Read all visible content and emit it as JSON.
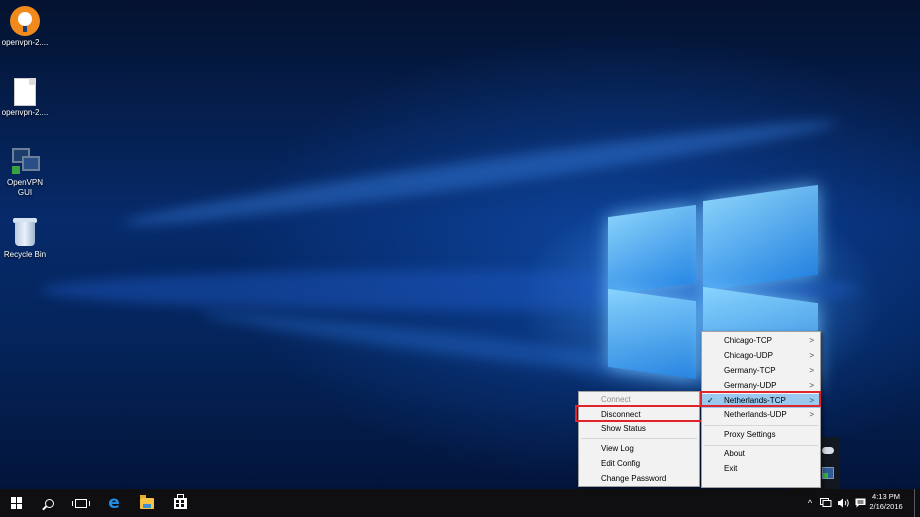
{
  "desktop": {
    "icons": [
      {
        "label": "openvpn-2....",
        "icon": "openvpn-logo-icon"
      },
      {
        "label": "openvpn-2....",
        "icon": "file-icon"
      },
      {
        "label_line1": "OpenVPN",
        "label_line2": "GUI",
        "icon": "openvpn-gui-icon"
      },
      {
        "label": "Recycle Bin",
        "icon": "recycle-bin-icon"
      }
    ]
  },
  "openvpn_menu": {
    "items": [
      {
        "label": "Connect",
        "enabled": false
      },
      {
        "label": "Disconnect",
        "highlighted_box": true
      },
      {
        "label": "Show Status"
      },
      {
        "label": "View Log"
      },
      {
        "label": "Edit Config"
      },
      {
        "label": "Change Password"
      }
    ]
  },
  "connections_menu": {
    "items": [
      {
        "label": "Chicago-TCP",
        "submenu": ">"
      },
      {
        "label": "Chicago-UDP",
        "submenu": ">"
      },
      {
        "label": "Germany-TCP",
        "submenu": ">"
      },
      {
        "label": "Germany-UDP",
        "submenu": ">"
      },
      {
        "label": "Netherlands-TCP",
        "submenu": ">",
        "checked": "✓",
        "selected": true
      },
      {
        "label": "Netherlands-UDP",
        "submenu": ">"
      },
      {
        "label": "Proxy Settings"
      },
      {
        "label": "About"
      },
      {
        "label": "Exit"
      }
    ]
  },
  "taskbar": {
    "pinned": [
      "start-icon",
      "search-icon",
      "task-view-icon",
      "edge-icon",
      "file-explorer-icon",
      "store-icon"
    ],
    "tray": {
      "chevron": "^",
      "network": "network-icon",
      "volume": "volume-icon",
      "notifications": "action-center-icon"
    },
    "time": "4:13 PM",
    "date": "2/16/2016"
  },
  "colors": {
    "highlight": "#99c9ef",
    "red_box": "#e0242b",
    "menu_bg": "#f2f2f2",
    "taskbar": "#0f0f12"
  }
}
